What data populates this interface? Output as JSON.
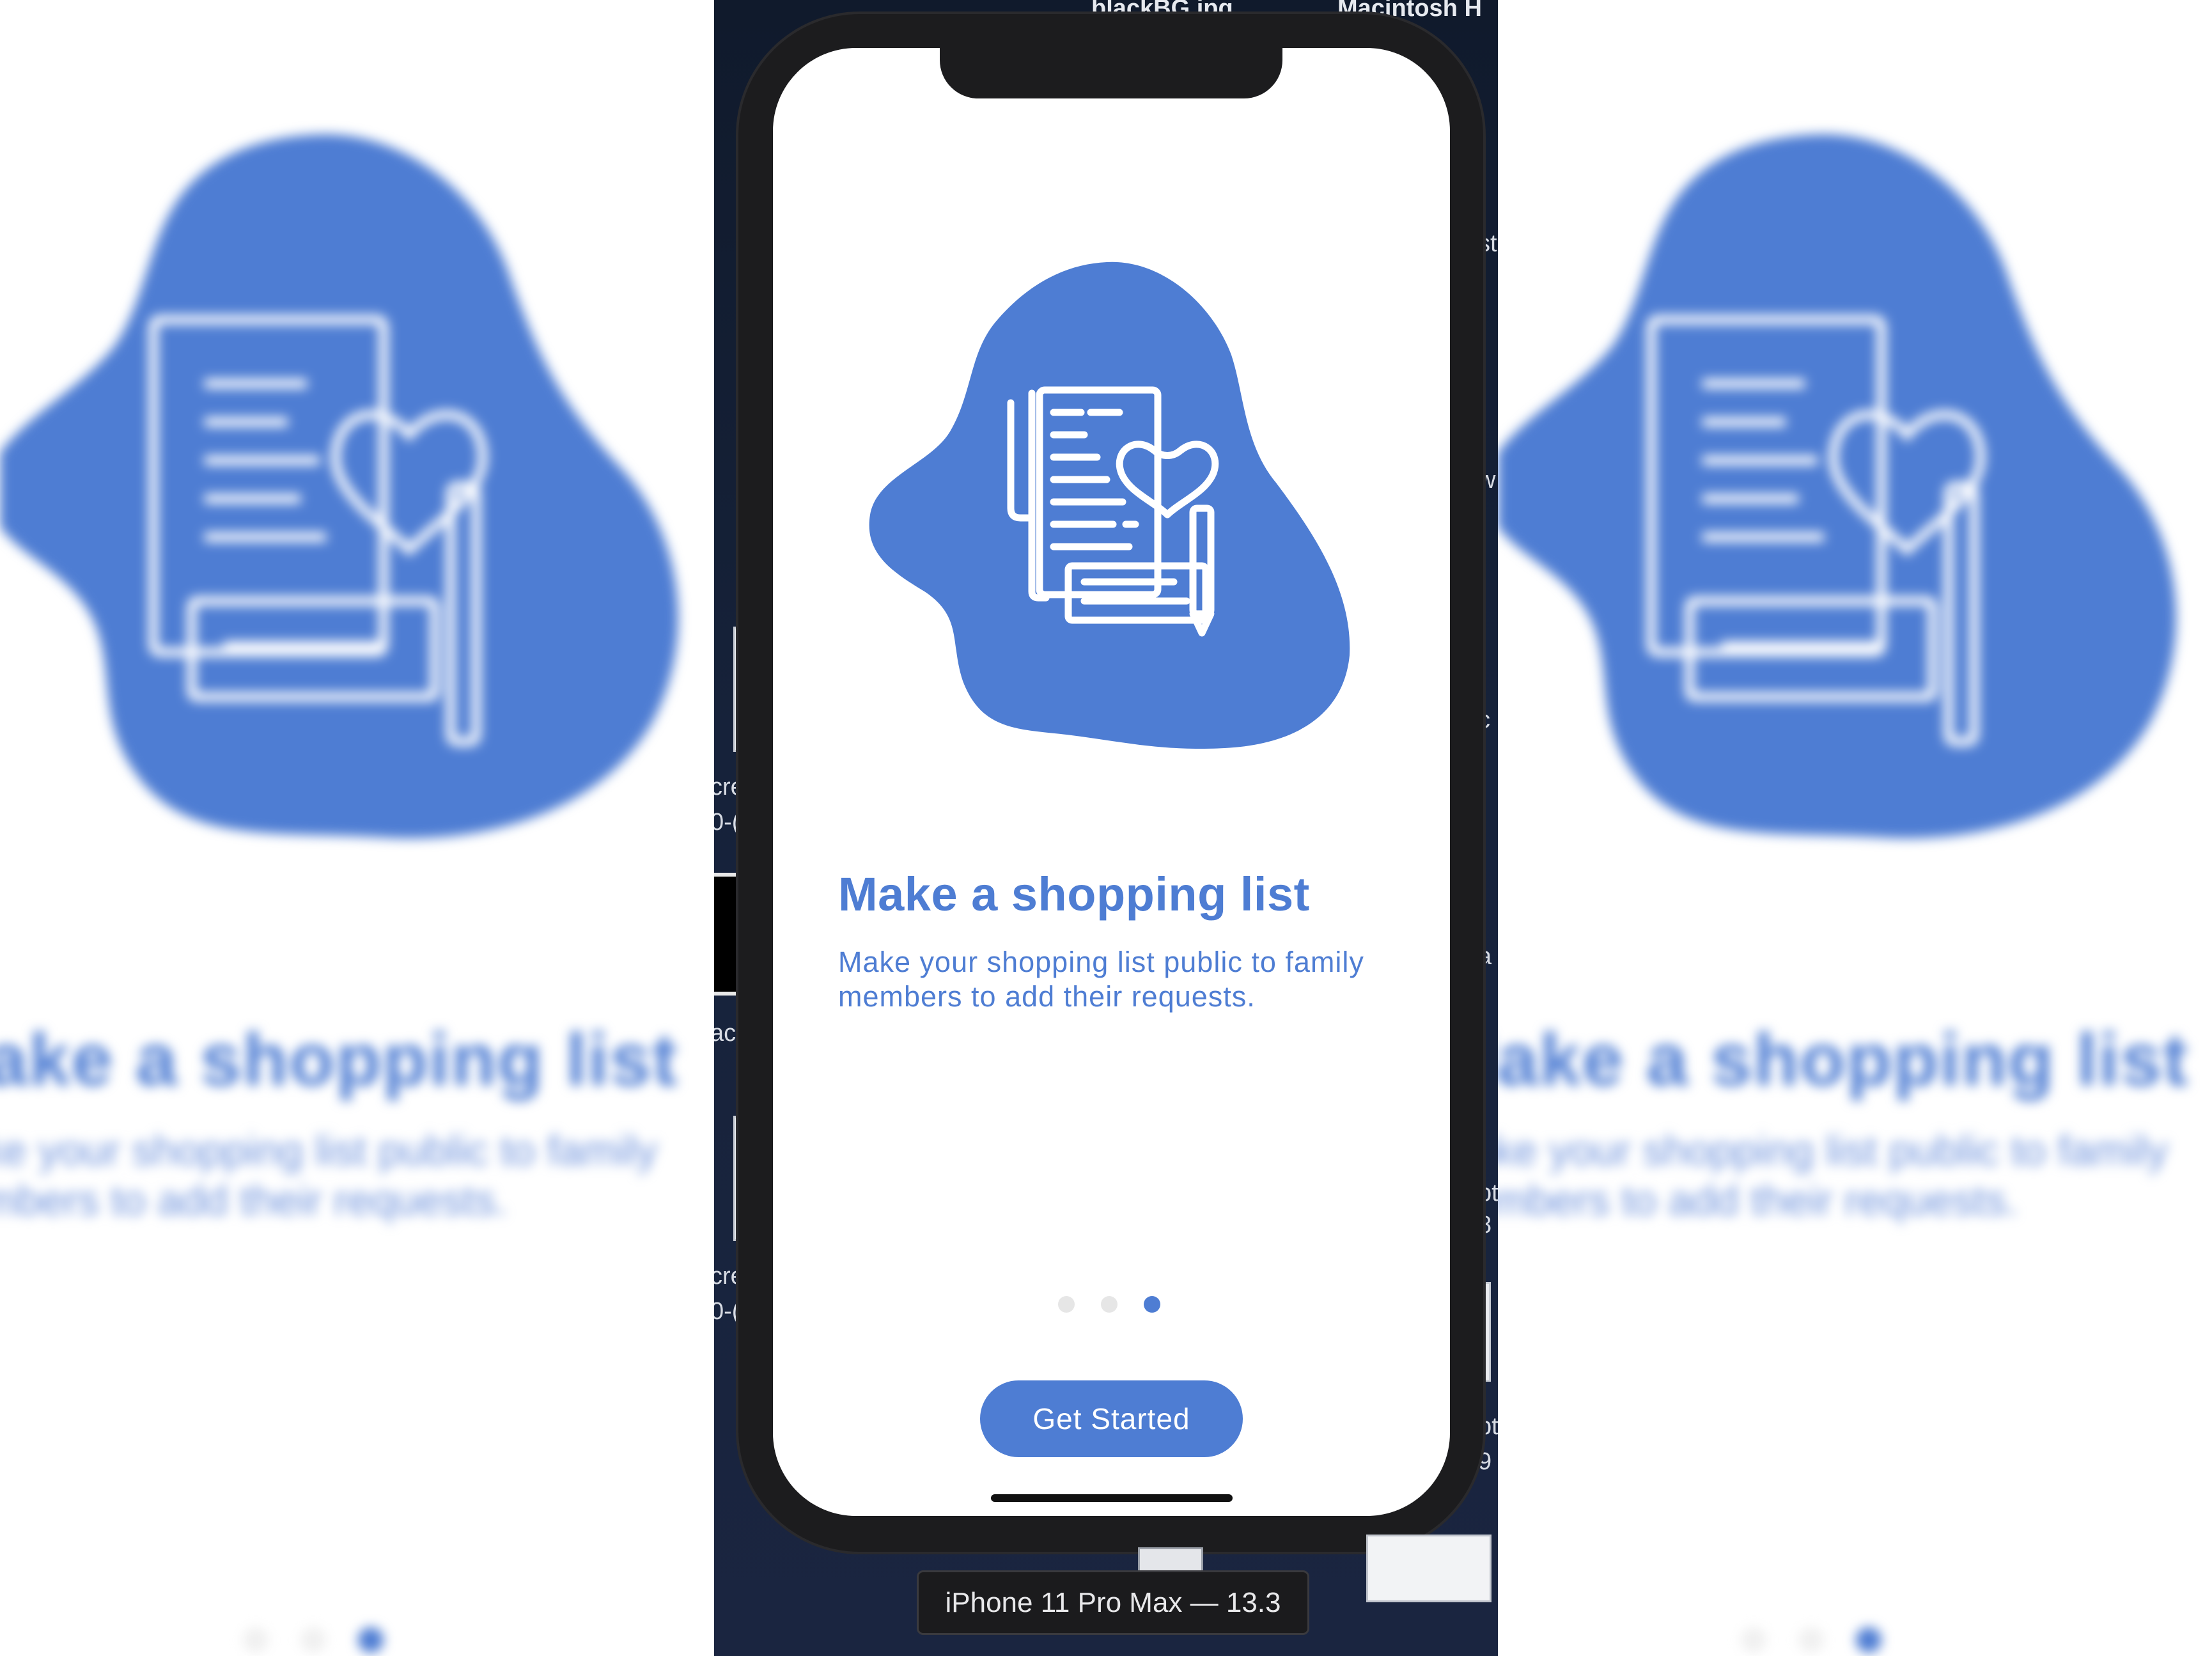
{
  "desktop": {
    "file_label": "blackBG.jpg",
    "disk_label": "Macintosh H",
    "fragments": [
      "st",
      "w",
      "c",
      "a",
      "pt",
      "8",
      "pt",
      "9",
      "cre",
      "0-(",
      "ac",
      "cre",
      "0-("
    ]
  },
  "onboarding": {
    "title": "Make a shopping list",
    "subtitle": "Make your shopping list public to family members to add their requests.",
    "page_count": 3,
    "current_page": 3,
    "cta_label": "Get Started",
    "illustration_icon": "shopping-list-heart-icon"
  },
  "simulator": {
    "device_label": "iPhone 11 Pro Max — 13.3"
  },
  "colors": {
    "accent": "#4e7dd3",
    "dot_inactive": "#e6e6e6",
    "background": "#ffffff"
  }
}
